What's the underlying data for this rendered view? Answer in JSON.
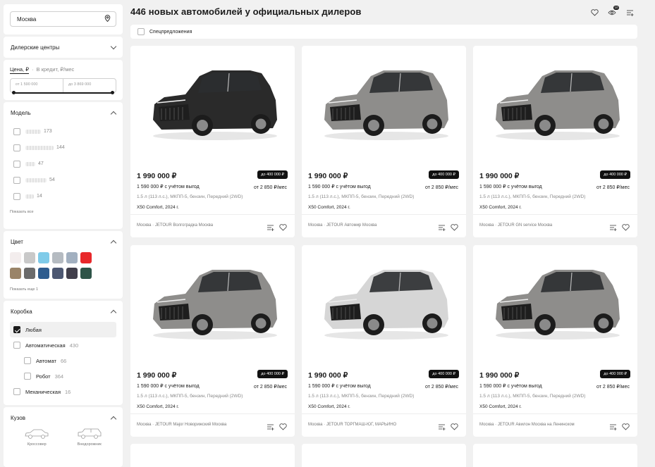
{
  "sidebar": {
    "city": "Москва",
    "dealers_label": "Дилерские центры",
    "price": {
      "tab_active": "Цена, ₽",
      "separator": "·",
      "tab_inactive": "В кредит, ₽/мес",
      "from_placeholder": "от 1 590 000",
      "to_placeholder": "до 3 869 000"
    },
    "model": {
      "title": "Модель",
      "items": [
        {
          "count": "173"
        },
        {
          "count": "144"
        },
        {
          "count": "47"
        },
        {
          "count": "54"
        },
        {
          "count": "14"
        }
      ],
      "show_all": "Показать все"
    },
    "color": {
      "title": "Цвет",
      "swatches": [
        "#f3eded",
        "#c9c9c9",
        "#7fcbe9",
        "#b5bbc1",
        "#a2b0c0",
        "#e8282b",
        "#9a8468",
        "#6b6b6b",
        "#2e5c8e",
        "#4d5872",
        "#413f4b",
        "#2e5448"
      ],
      "show_more": "Показать еще 1"
    },
    "gearbox": {
      "title": "Коробка",
      "items": [
        {
          "label": "Любая",
          "count": "",
          "checked": true
        },
        {
          "label": "Автоматическая",
          "count": "430"
        },
        {
          "label": "Автомат",
          "count": "66"
        },
        {
          "label": "Робот",
          "count": "364"
        },
        {
          "label": "Механическая",
          "count": "16"
        }
      ]
    },
    "body": {
      "title": "Кузов",
      "options": [
        "Кроссовер",
        "Внедорожник"
      ]
    }
  },
  "header": {
    "title": "446 новых автомобилей у официальных дилеров",
    "compare_badge": "10",
    "special_offers": "Спецпредложения"
  },
  "cards": [
    {
      "color": "#2a2a2a",
      "price": "1 990 000 ₽",
      "discount": "до 400 000 ₽",
      "credit_price": "1 590 000 ₽ с учётом выгод",
      "monthly": "от 2 850 ₽/мес",
      "specs": "1.5 л (113 л.с.),  МКПП-5,  бензин,  Передний (2WD)",
      "trim": "X50 Comfort, 2024 г.",
      "dealer": "Москва  ·  JETOUR Волгоградка Москва"
    },
    {
      "color": "#8e8d8b",
      "price": "1 990 000 ₽",
      "discount": "до 400 000 ₽",
      "credit_price": "1 590 000 ₽ с учётом выгод",
      "monthly": "от 2 850 ₽/мес",
      "specs": "1.5 л (113 л.с.),  МКПП-5,  бензин,  Передний (2WD)",
      "trim": "X50 Comfort, 2024 г.",
      "dealer": "Москва  ·  JETOUR Автомир Москва"
    },
    {
      "color": "#8e8d8b",
      "price": "1 990 000 ₽",
      "discount": "до 400 000 ₽",
      "credit_price": "1 590 000 ₽ с учётом выгод",
      "monthly": "от 2 850 ₽/мес",
      "specs": "1.5 л (113 л.с.),  МКПП-5,  бензин,  Передний (2WD)",
      "trim": "X50 Comfort, 2024 г.",
      "dealer": "Москва  ·  JETOUR GN service Москва"
    },
    {
      "color": "#8e8d8b",
      "price": "1 990 000 ₽",
      "discount": "до 400 000 ₽",
      "credit_price": "1 590 000 ₽ с учётом выгод",
      "monthly": "от 2 850 ₽/мес",
      "specs": "1.5 л (113 л.с.),  МКПП-5,  бензин,  Передний (2WD)",
      "trim": "X50 Comfort, 2024 г.",
      "dealer": "Москва  ·  JETOUR Major Новорижский Москва"
    },
    {
      "color": "#d6d6d6",
      "price": "1 990 000 ₽",
      "discount": "до 400 000 ₽",
      "credit_price": "1 590 000 ₽ с учётом выгод",
      "monthly": "от 2 850 ₽/мес",
      "specs": "1.5 л (113 л.с.),  МКПП-5,  бензин,  Передний (2WD)",
      "trim": "X50 Comfort, 2024 г.",
      "dealer": "Москва  ·  JETOUR ТОРГМАШ-ЮГ, МАРЬИНО"
    },
    {
      "color": "#8e8d8b",
      "price": "1 990 000 ₽",
      "discount": "до 400 000 ₽",
      "credit_price": "1 590 000 ₽ с учётом выгод",
      "monthly": "от 2 850 ₽/мес",
      "specs": "1.5 л (113 л.с.),  МКПП-5,  бензин,  Передний (2WD)",
      "trim": "X50 Comfort, 2024 г.",
      "dealer": "Москва  ·  JETOUR Авилон Москва на Ленинском"
    }
  ]
}
